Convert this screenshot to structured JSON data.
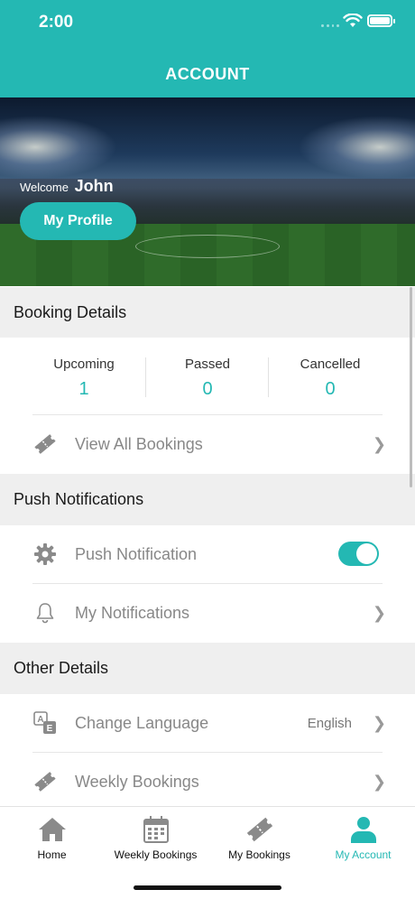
{
  "status_bar": {
    "time": "2:00"
  },
  "header": {
    "title": "ACCOUNT"
  },
  "hero": {
    "welcome_label": "Welcome",
    "user_name": "John",
    "profile_button": "My Profile"
  },
  "booking": {
    "section_title": "Booking Details",
    "stats": [
      {
        "label": "Upcoming",
        "value": "1"
      },
      {
        "label": "Passed",
        "value": "0"
      },
      {
        "label": "Cancelled",
        "value": "0"
      }
    ],
    "view_all": "View All Bookings"
  },
  "notifications": {
    "section_title": "Push Notifications",
    "push_label": "Push Notification",
    "push_enabled": true,
    "my_notifications": "My Notifications"
  },
  "other": {
    "section_title": "Other Details",
    "change_language": "Change Language",
    "language_value": "English",
    "weekly_bookings": "Weekly Bookings"
  },
  "tabs": [
    {
      "label": "Home",
      "icon": "home-icon",
      "active": false
    },
    {
      "label": "Weekly Bookings",
      "icon": "calendar-icon",
      "active": false
    },
    {
      "label": "My Bookings",
      "icon": "ticket-icon",
      "active": false
    },
    {
      "label": "My Account",
      "icon": "account-icon",
      "active": true
    }
  ],
  "colors": {
    "accent": "#24b8b3",
    "section_bg": "#efefef",
    "icon_gray": "#8a8a8a"
  }
}
